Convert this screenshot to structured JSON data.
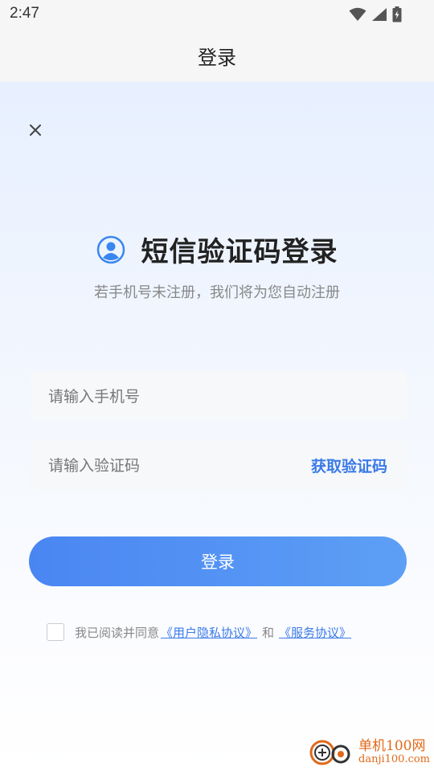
{
  "status_bar": {
    "time": "2:47"
  },
  "app_bar": {
    "title": "登录"
  },
  "header": {
    "title": "短信验证码登录",
    "subtitle": "若手机号未注册，我们将为您自动注册"
  },
  "form": {
    "phone_placeholder": "请输入手机号",
    "code_placeholder": "请输入验证码",
    "get_code_label": "获取验证码",
    "login_label": "登录"
  },
  "agreement": {
    "prefix": "我已阅读并同意",
    "privacy_link": "《用户隐私协议》",
    "conjunction": "和",
    "service_link": "《服务协议》",
    "checked": false
  },
  "watermark": {
    "name": "单机100网",
    "url": "danji100.com"
  },
  "colors": {
    "accent": "#3a7ae8",
    "button_start": "#4a86f2",
    "button_end": "#5d9ff5",
    "background_top": "#e7f0ff",
    "watermark": "#e06a1a"
  },
  "icons": {
    "close": "close-icon",
    "user": "user-icon",
    "wifi": "wifi-icon",
    "signal": "signal-icon",
    "battery": "battery-charging-icon"
  }
}
